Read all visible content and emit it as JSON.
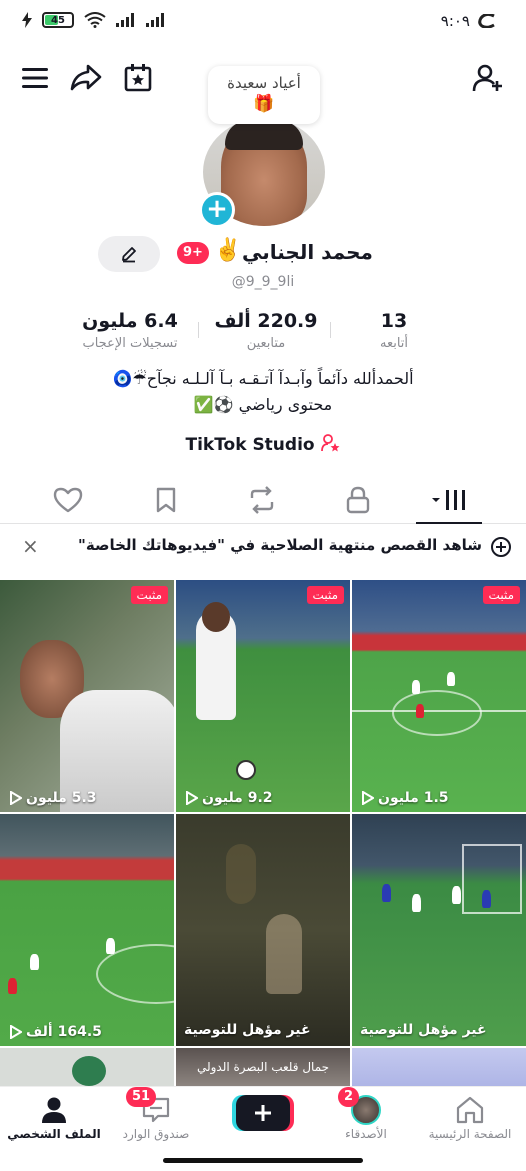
{
  "status": {
    "battery": "45",
    "time": "٩:٠٩"
  },
  "note": {
    "text": "أعياد سعيدة",
    "emoji": "🎁"
  },
  "profile": {
    "name": "محمد الجنابي",
    "badge": "9+",
    "emoji": "✌️",
    "handle": "@9_9_9li",
    "bio_line1": "ألحمدألله دآئماً وآبـدآ آتـقـه بـآ آلـلـه نجآح☔🧿",
    "bio_line2": "محتوى رياضي ⚽✅",
    "studio": "TikTok Studio"
  },
  "stats": {
    "likes_num": "6.4 مليون",
    "likes_label": "تسجيلات الإعجاب",
    "followers_num": "220.9 ألف",
    "followers_label": "متابعين",
    "following_num": "13",
    "following_label": "أتابعه"
  },
  "story_banner": "شاهد القصص منتهية الصلاحية في \"فيديوهاتك الخاصة\"",
  "videos": [
    {
      "pinned": "مثبت",
      "views": "5.3 مليون"
    },
    {
      "pinned": "مثبت",
      "views": "9.2 مليون"
    },
    {
      "pinned": "مثبت",
      "views": "1.5 مليون"
    },
    {
      "views": "164.5 ألف"
    },
    {
      "status": "غير مؤهل للتوصية"
    },
    {
      "status": "غير مؤهل للتوصية"
    },
    {
      "caption": ""
    },
    {
      "caption": "جمال قلعب البصرة الدولي"
    },
    {
      "caption": ""
    }
  ],
  "nav": {
    "home": "الصفحة الرئيسية",
    "friends": "الأصدقاء",
    "friends_badge": "2",
    "inbox": "صندوق الوارد",
    "inbox_badge": "51",
    "profile": "الملف الشخصي"
  },
  "colors": {
    "accent": "#fe2c55",
    "blue": "#20b5d6"
  }
}
